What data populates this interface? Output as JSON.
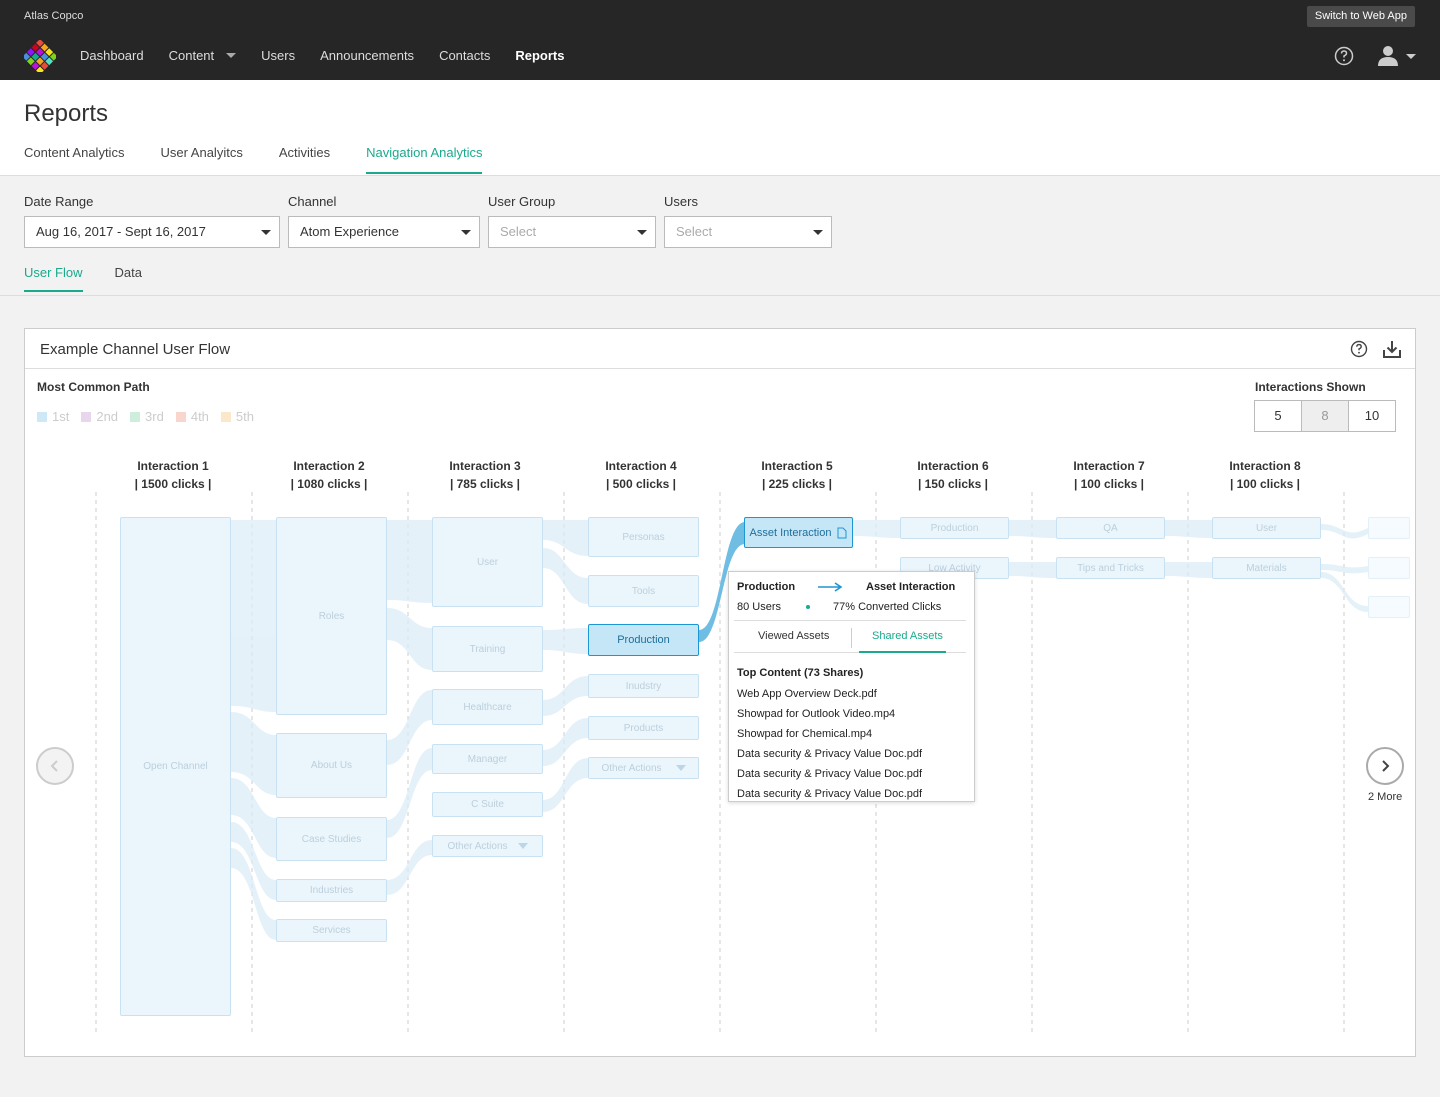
{
  "topbar": {
    "org": "Atlas Copco",
    "switch_label": "Switch to Web App",
    "nav": [
      "Dashboard",
      "Content",
      "Users",
      "Announcements",
      "Contacts",
      "Reports"
    ]
  },
  "page": {
    "title": "Reports",
    "tabs": [
      "Content Analytics",
      "User Analyitcs",
      "Activities",
      "Navigation Analytics"
    ]
  },
  "filters": {
    "date_label": "Date Range",
    "date_value": "Aug 16, 2017 - Sept 16, 2017",
    "channel_label": "Channel",
    "channel_value": "Atom Experience",
    "group_label": "User Group",
    "group_placeholder": "Select",
    "users_label": "Users",
    "users_placeholder": "Select"
  },
  "subtabs": [
    "User Flow",
    "Data"
  ],
  "panel": {
    "title": "Example Channel User Flow",
    "most_common_path": "Most Common Path",
    "legend": [
      {
        "label": "1st",
        "color": "#cfe8f8"
      },
      {
        "label": "2nd",
        "color": "#e7d6ec"
      },
      {
        "label": "3rd",
        "color": "#cdeedd"
      },
      {
        "label": "4th",
        "color": "#f8d5cd"
      },
      {
        "label": "5th",
        "color": "#fbe7c9"
      }
    ],
    "interactions_label": "Interactions Shown",
    "interactions_options": [
      "5",
      "8",
      "10"
    ],
    "interactions_selected": "8",
    "more_label": "2 More"
  },
  "interactions": [
    {
      "name": "Interaction 1",
      "clicks": "| 1500 clicks |"
    },
    {
      "name": "Interaction 2",
      "clicks": "| 1080 clicks |"
    },
    {
      "name": "Interaction 3",
      "clicks": "| 785 clicks |"
    },
    {
      "name": "Interaction 4",
      "clicks": "| 500 clicks |"
    },
    {
      "name": "Interaction 5",
      "clicks": "| 225 clicks |"
    },
    {
      "name": "Interaction 6",
      "clicks": "| 150 clicks |"
    },
    {
      "name": "Interaction 7",
      "clicks": "| 100 clicks |"
    },
    {
      "name": "Interaction 8",
      "clicks": "| 100 clicks |"
    }
  ],
  "nodes": {
    "open_channel": "Open Channel",
    "roles": "Roles",
    "about_us": "About Us",
    "case_studies": "Case Studies",
    "industries": "Industries",
    "services": "Services",
    "user3": "User",
    "training": "Training",
    "healthcare": "Healthcare",
    "manager": "Manager",
    "c_suite": "C Suite",
    "other_actions3": "Other Actions",
    "personas": "Personas",
    "tools": "Tools",
    "production4": "Production",
    "indusrty": "Inudstry",
    "products": "Products",
    "other_actions4": "Other Actions",
    "asset_interaction": "Asset Interaction",
    "production6": "Production",
    "low_activity": "Low Activity",
    "qa": "QA",
    "tips": "Tips and Tricks",
    "user8": "User",
    "materials": "Materials"
  },
  "tooltip": {
    "from": "Production",
    "to": "Asset Interaction",
    "users": "80 Users",
    "converted": "77% Converted Clicks",
    "tab_viewed": "Viewed Assets",
    "tab_shared": "Shared Assets",
    "top_content": "Top Content (73 Shares)",
    "items": [
      "Web App Overview Deck.pdf",
      "Showpad for Outlook Video.mp4",
      "Showpad for Chemical.mp4",
      "Data security & Privacy Value Doc.pdf",
      "Data security & Privacy Value Doc.pdf",
      "Data security & Privacy Value Doc.pdf"
    ]
  }
}
